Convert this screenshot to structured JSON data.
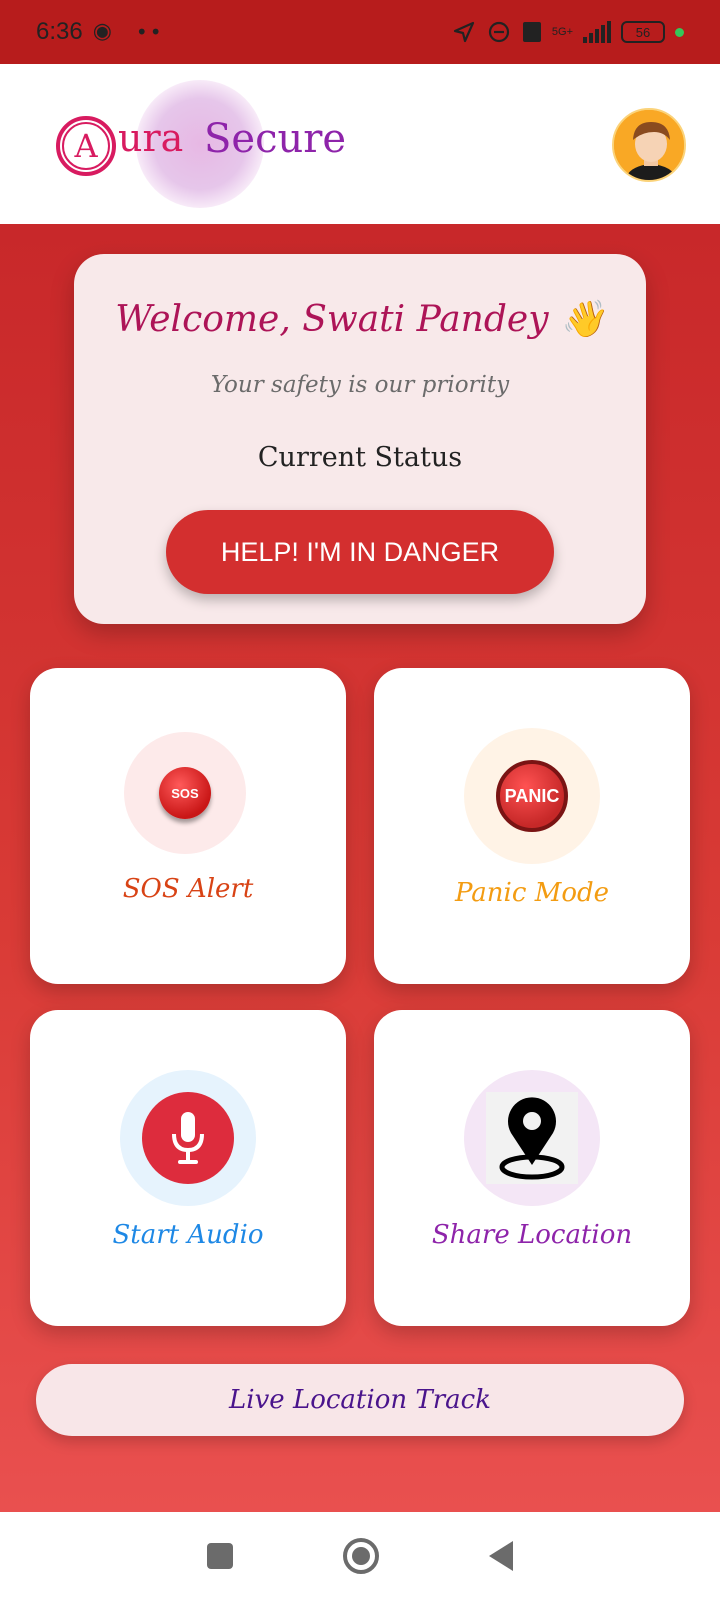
{
  "status_bar": {
    "time": "6:36",
    "network": "5G+",
    "battery": "56",
    "icons": [
      "location-icon",
      "link-icon",
      "volte-icon",
      "signal-icon",
      "battery-icon"
    ]
  },
  "header": {
    "logo_letter": "A",
    "logo_text_1": "ura",
    "logo_text_2": "Secure",
    "colors": {
      "logo_pink": "#d81b60",
      "logo_purple": "#8e24aa"
    }
  },
  "welcome": {
    "title": "Welcome, Swati Pandey 👋",
    "subtitle": "Your safety is our priority",
    "status_label": "Current Status",
    "danger_button": "HELP! I'M IN DANGER"
  },
  "tiles": [
    {
      "label": "SOS Alert",
      "icon": "sos-button-icon",
      "icon_text": "SOS",
      "color": "#d84315"
    },
    {
      "label": "Panic Mode",
      "icon": "panic-button-icon",
      "icon_text": "PANIC",
      "color": "#f39c12"
    },
    {
      "label": "Start Audio",
      "icon": "microphone-icon",
      "color": "#1e88e5"
    },
    {
      "label": "Share Location",
      "icon": "location-pin-icon",
      "color": "#8e24aa"
    }
  ],
  "live_location_button": "Live Location Track",
  "colors": {
    "primary_red": "#d32f2f",
    "card_bg": "#f8e9ea"
  }
}
